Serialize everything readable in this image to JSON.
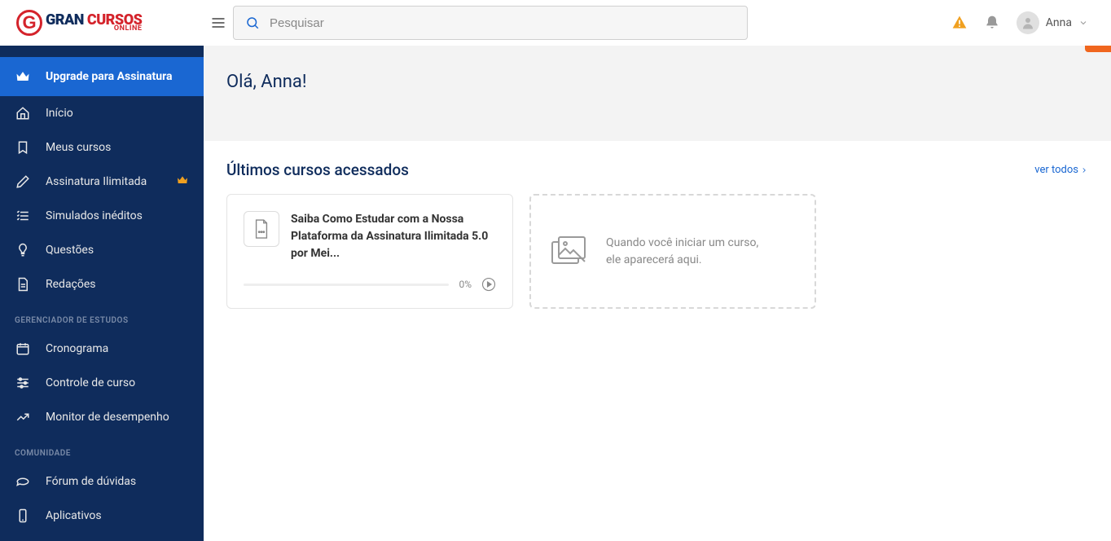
{
  "header": {
    "search_placeholder": "Pesquisar",
    "user_name": "Anna"
  },
  "sidebar": {
    "upgrade_label": "Upgrade para Assinatura",
    "main_items": [
      {
        "label": "Início",
        "icon": "home"
      },
      {
        "label": "Meus cursos",
        "icon": "bookmark"
      },
      {
        "label": "Assinatura Ilimitada",
        "icon": "pen",
        "crown": true
      },
      {
        "label": "Simulados inéditos",
        "icon": "list"
      },
      {
        "label": "Questões",
        "icon": "bulb"
      },
      {
        "label": "Redações",
        "icon": "doc"
      }
    ],
    "section1_label": "GERENCIADOR DE ESTUDOS",
    "section1_items": [
      {
        "label": "Cronograma",
        "icon": "calendar"
      },
      {
        "label": "Controle de curso",
        "icon": "sliders"
      },
      {
        "label": "Monitor de desempenho",
        "icon": "chart"
      }
    ],
    "section2_label": "COMUNIDADE",
    "section2_items": [
      {
        "label": "Fórum de dúvidas",
        "icon": "chat"
      },
      {
        "label": "Aplicativos",
        "icon": "phone"
      }
    ]
  },
  "main": {
    "greeting": "Olá, Anna!",
    "section_title": "Últimos cursos acessados",
    "see_all": "ver todos",
    "course": {
      "title": "Saiba Como Estudar com a Nossa Plataforma da Assinatura Ilimitada 5.0 por Mei...",
      "progress": "0%"
    },
    "placeholder": {
      "line1": "Quando você iniciar um curso,",
      "line2": "ele aparecerá aqui."
    }
  }
}
